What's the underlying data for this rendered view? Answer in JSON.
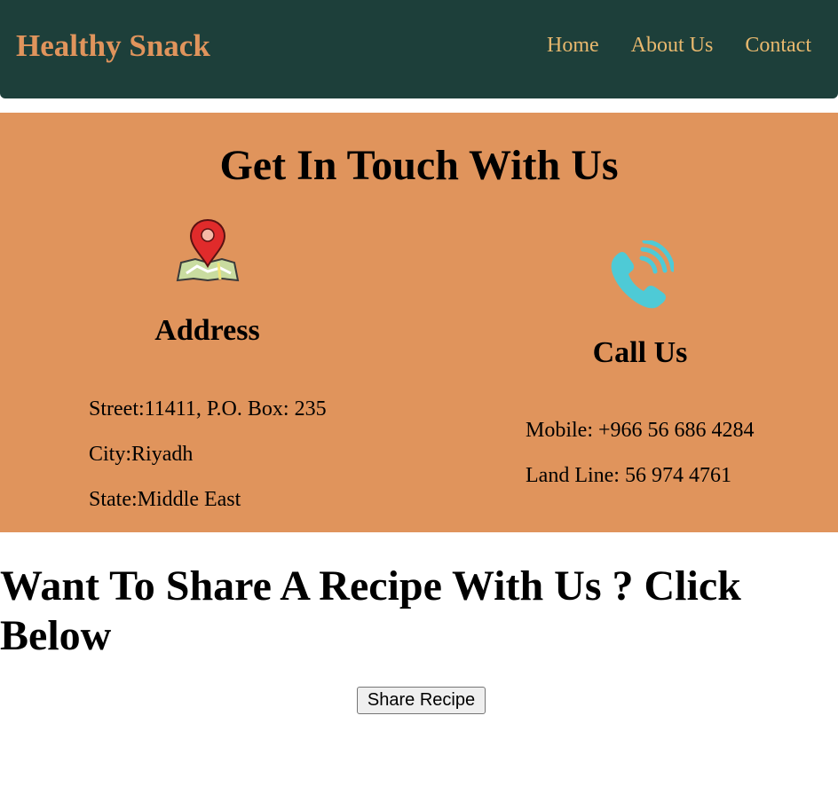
{
  "nav": {
    "brand": "Healthy Snack",
    "links": [
      {
        "label": "Home"
      },
      {
        "label": "About Us"
      },
      {
        "label": "Contact"
      }
    ]
  },
  "contact": {
    "title": "Get In Touch With Us",
    "address": {
      "icon": "map-pin-icon",
      "heading": "Address",
      "lines": [
        "Street:11411, P.O. Box: 235",
        "City:Riyadh",
        "State:Middle East"
      ]
    },
    "call": {
      "icon": "phone-icon",
      "heading": "Call Us",
      "lines": [
        "Mobile: +966 56 686 4284",
        "Land Line: 56 974 4761"
      ]
    }
  },
  "share": {
    "title": "Want To Share A Recipe With Us ? Click Below",
    "button_label": "Share Recipe"
  },
  "colors": {
    "navbar_bg": "#1d3f3a",
    "brand": "#e0945c",
    "nav_link": "#e8b86e",
    "contact_bg": "#e0945c",
    "phone_icon": "#4ecad6",
    "pin_red": "#e02b2b"
  }
}
